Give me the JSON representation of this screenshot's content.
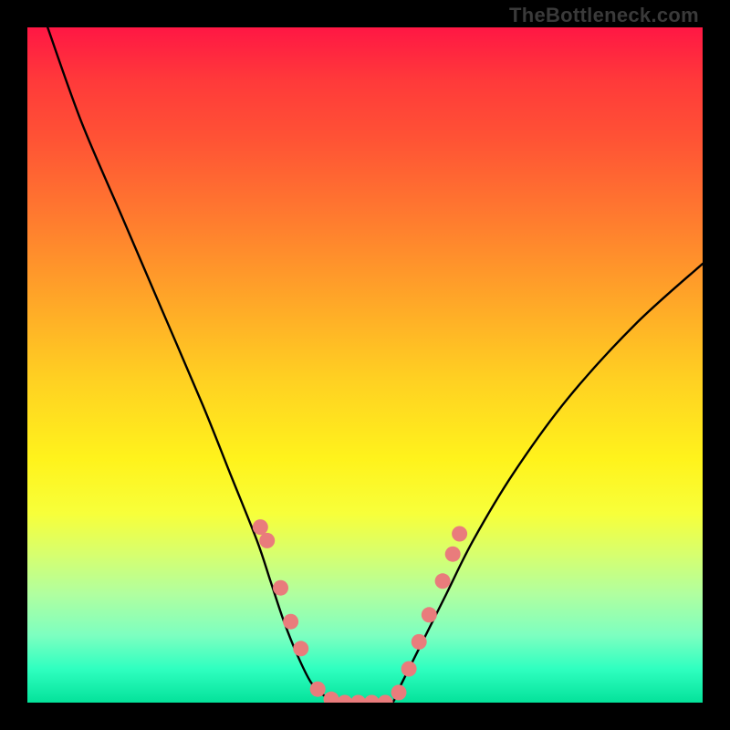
{
  "watermark": "TheBottleneck.com",
  "chart_data": {
    "type": "line",
    "title": "",
    "xlabel": "",
    "ylabel": "",
    "xlim": [
      0,
      100
    ],
    "ylim": [
      0,
      100
    ],
    "series": [
      {
        "name": "bottleneck-curve",
        "x": [
          3,
          8,
          14,
          20,
          26,
          30,
          34,
          36,
          38,
          40,
          42,
          44,
          46,
          48,
          50,
          52,
          54,
          55,
          58,
          62,
          66,
          72,
          80,
          90,
          100
        ],
        "y": [
          100,
          86,
          72,
          58,
          44,
          34,
          24,
          18,
          12,
          7,
          3,
          1,
          0,
          0,
          0,
          0,
          0,
          2,
          8,
          16,
          24,
          34,
          45,
          56,
          65
        ]
      }
    ],
    "markers": [
      {
        "x": 34.5,
        "y": 26
      },
      {
        "x": 35.5,
        "y": 24
      },
      {
        "x": 37.5,
        "y": 17
      },
      {
        "x": 39.0,
        "y": 12
      },
      {
        "x": 40.5,
        "y": 8
      },
      {
        "x": 43.0,
        "y": 2
      },
      {
        "x": 45.0,
        "y": 0.5
      },
      {
        "x": 47.0,
        "y": 0
      },
      {
        "x": 49.0,
        "y": 0
      },
      {
        "x": 51.0,
        "y": 0
      },
      {
        "x": 53.0,
        "y": 0
      },
      {
        "x": 55.0,
        "y": 1.5
      },
      {
        "x": 56.5,
        "y": 5
      },
      {
        "x": 58.0,
        "y": 9
      },
      {
        "x": 59.5,
        "y": 13
      },
      {
        "x": 61.5,
        "y": 18
      },
      {
        "x": 63.0,
        "y": 22
      },
      {
        "x": 64.0,
        "y": 25
      }
    ],
    "marker_color": "#e97c7c",
    "curve_color": "#000000",
    "gradient_bands_approx": [
      {
        "label": "red",
        "y_from": 70,
        "y_to": 100
      },
      {
        "label": "orange",
        "y_from": 45,
        "y_to": 70
      },
      {
        "label": "yellow",
        "y_from": 20,
        "y_to": 45
      },
      {
        "label": "green",
        "y_from": 0,
        "y_to": 20
      }
    ]
  }
}
